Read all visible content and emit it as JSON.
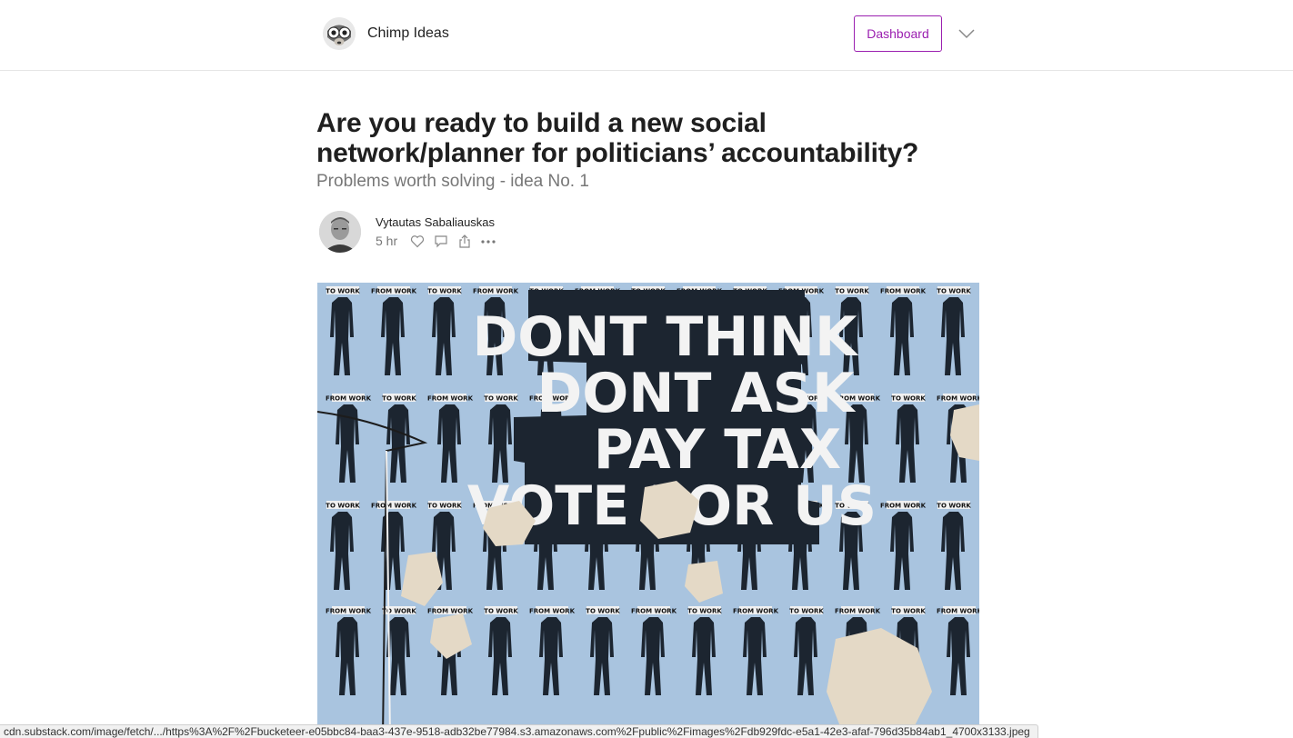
{
  "header": {
    "publication_name": "Chimp Ideas",
    "dashboard_label": "Dashboard"
  },
  "article": {
    "title": "Are you ready to build a new social network/planner for politicians’ accountability?",
    "subtitle": "Problems worth solving - idea No. 1",
    "author_name": "Vytautas Sabaliauskas",
    "time_ago": "5 hr",
    "hero_image": {
      "lines": [
        "DONT THINK",
        "DONT ASK",
        "PAY TAX",
        "VOTE FOR US"
      ],
      "sticker_labels": [
        "TO WORK",
        "FROM WORK"
      ]
    }
  },
  "status_bar": {
    "url": "cdn.substack.com/image/fetch/.../https%3A%2F%2Fbucketeer-e05bbc84-baa3-437e-9518-adb32be77984.s3.amazonaws.com%2Fpublic%2Fimages%2Fdb929fdc-e5a1-42e3-afaf-796d35b84ab1_4700x3133.jpeg"
  },
  "colors": {
    "accent": "#9b1fb0",
    "hero_wall": "#a9c4df",
    "poster": "#1c2530"
  },
  "icons": [
    "chimp-logo-icon",
    "chevron-down-icon",
    "heart-icon",
    "comment-icon",
    "share-icon",
    "more-icon"
  ]
}
